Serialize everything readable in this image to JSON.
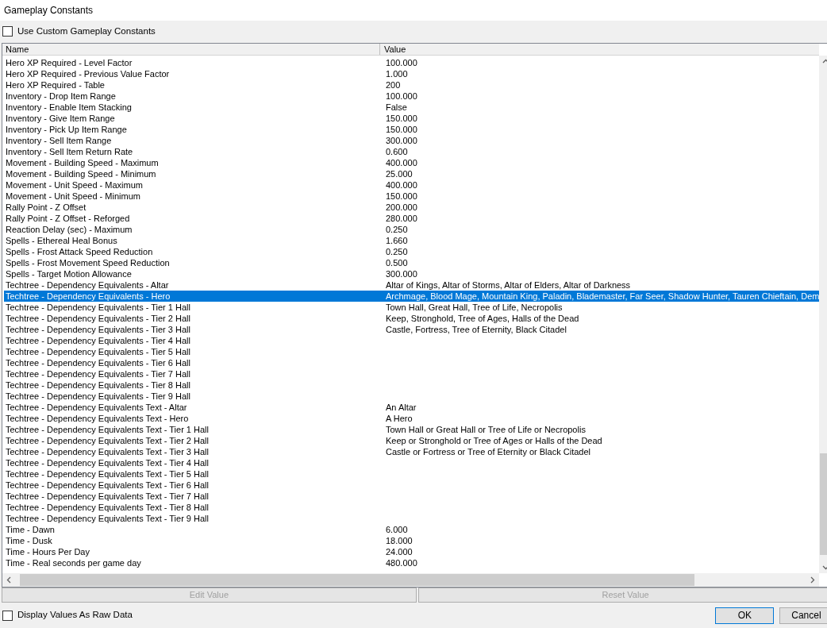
{
  "window": {
    "title": "Gameplay Constants"
  },
  "use_custom": {
    "label": "Use Custom Gameplay Constants",
    "checked": false
  },
  "table": {
    "columns": [
      "Name",
      "Value"
    ],
    "rows": [
      {
        "name": "Hero XP Required - Level Factor",
        "value": "100.000",
        "selected": false
      },
      {
        "name": "Hero XP Required - Previous Value Factor",
        "value": "1.000",
        "selected": false
      },
      {
        "name": "Hero XP Required - Table",
        "value": "200",
        "selected": false
      },
      {
        "name": "Inventory - Drop Item Range",
        "value": "100.000",
        "selected": false
      },
      {
        "name": "Inventory - Enable Item Stacking",
        "value": "False",
        "selected": false
      },
      {
        "name": "Inventory - Give Item Range",
        "value": "150.000",
        "selected": false
      },
      {
        "name": "Inventory - Pick Up Item Range",
        "value": "150.000",
        "selected": false
      },
      {
        "name": "Inventory - Sell Item Range",
        "value": "300.000",
        "selected": false
      },
      {
        "name": "Inventory - Sell Item Return Rate",
        "value": "0.600",
        "selected": false
      },
      {
        "name": "Movement - Building Speed - Maximum",
        "value": "400.000",
        "selected": false
      },
      {
        "name": "Movement - Building Speed - Minimum",
        "value": "25.000",
        "selected": false
      },
      {
        "name": "Movement - Unit Speed - Maximum",
        "value": "400.000",
        "selected": false
      },
      {
        "name": "Movement - Unit Speed - Minimum",
        "value": "150.000",
        "selected": false
      },
      {
        "name": "Rally Point - Z Offset",
        "value": "200.000",
        "selected": false
      },
      {
        "name": "Rally Point - Z Offset - Reforged",
        "value": "280.000",
        "selected": false
      },
      {
        "name": "Reaction Delay (sec) - Maximum",
        "value": "0.250",
        "selected": false
      },
      {
        "name": "Spells - Ethereal Heal Bonus",
        "value": "1.660",
        "selected": false
      },
      {
        "name": "Spells - Frost Attack Speed Reduction",
        "value": "0.250",
        "selected": false
      },
      {
        "name": "Spells - Frost Movement Speed Reduction",
        "value": "0.500",
        "selected": false
      },
      {
        "name": "Spells - Target Motion Allowance",
        "value": "300.000",
        "selected": false
      },
      {
        "name": "Techtree - Dependency Equivalents - Altar",
        "value": "Altar of Kings, Altar of Storms, Altar of Elders, Altar of Darkness",
        "selected": false
      },
      {
        "name": "Techtree - Dependency Equivalents - Hero",
        "value": "Archmage, Blood Mage, Mountain King, Paladin, Blademaster, Far Seer, Shadow Hunter, Tauren Chieftain, Dem",
        "selected": true
      },
      {
        "name": "Techtree - Dependency Equivalents - Tier 1 Hall",
        "value": "Town Hall, Great Hall, Tree of Life, Necropolis",
        "selected": false
      },
      {
        "name": "Techtree - Dependency Equivalents - Tier 2 Hall",
        "value": "Keep, Stronghold, Tree of Ages, Halls of the Dead",
        "selected": false
      },
      {
        "name": "Techtree - Dependency Equivalents - Tier 3 Hall",
        "value": "Castle, Fortress, Tree of Eternity, Black Citadel",
        "selected": false
      },
      {
        "name": "Techtree - Dependency Equivalents - Tier 4 Hall",
        "selected": false
      },
      {
        "name": "Techtree - Dependency Equivalents - Tier 5 Hall",
        "selected": false
      },
      {
        "name": "Techtree - Dependency Equivalents - Tier 6 Hall",
        "selected": false
      },
      {
        "name": "Techtree - Dependency Equivalents - Tier 7 Hall",
        "selected": false
      },
      {
        "name": "Techtree - Dependency Equivalents - Tier 8 Hall",
        "selected": false
      },
      {
        "name": "Techtree - Dependency Equivalents - Tier 9 Hall",
        "selected": false
      },
      {
        "name": "Techtree - Dependency Equivalents Text - Altar",
        "value": "An Altar",
        "selected": false
      },
      {
        "name": "Techtree - Dependency Equivalents Text - Hero",
        "value": "A Hero",
        "selected": false
      },
      {
        "name": "Techtree - Dependency Equivalents Text - Tier 1 Hall",
        "value": "Town Hall or Great Hall or Tree of Life or Necropolis",
        "selected": false
      },
      {
        "name": "Techtree - Dependency Equivalents Text - Tier 2 Hall",
        "value": "Keep or Stronghold or Tree of Ages or Halls of the Dead",
        "selected": false
      },
      {
        "name": "Techtree - Dependency Equivalents Text - Tier 3 Hall",
        "value": "Castle or Fortress or Tree of Eternity or Black Citadel",
        "selected": false
      },
      {
        "name": "Techtree - Dependency Equivalents Text - Tier 4 Hall",
        "selected": false
      },
      {
        "name": "Techtree - Dependency Equivalents Text - Tier 5 Hall",
        "selected": false
      },
      {
        "name": "Techtree - Dependency Equivalents Text - Tier 6 Hall",
        "selected": false
      },
      {
        "name": "Techtree - Dependency Equivalents Text - Tier 7 Hall",
        "selected": false
      },
      {
        "name": "Techtree - Dependency Equivalents Text - Tier 8 Hall",
        "selected": false
      },
      {
        "name": "Techtree - Dependency Equivalents Text - Tier 9 Hall",
        "selected": false
      },
      {
        "name": "Time - Dawn",
        "value": "6.000",
        "selected": false
      },
      {
        "name": "Time - Dusk",
        "value": "18.000",
        "selected": false
      },
      {
        "name": "Time - Hours Per Day",
        "value": "24.000",
        "selected": false
      },
      {
        "name": "Time - Real seconds per game day",
        "value": "480.000",
        "selected": false
      }
    ]
  },
  "action_buttons": [
    {
      "label": "Edit Value",
      "disabled": true
    },
    {
      "label": "Reset Value",
      "disabled": true
    }
  ],
  "raw_data": {
    "label": "Display Values As Raw Data",
    "checked": false
  },
  "dialog_buttons": [
    "OK",
    "Cancel"
  ]
}
